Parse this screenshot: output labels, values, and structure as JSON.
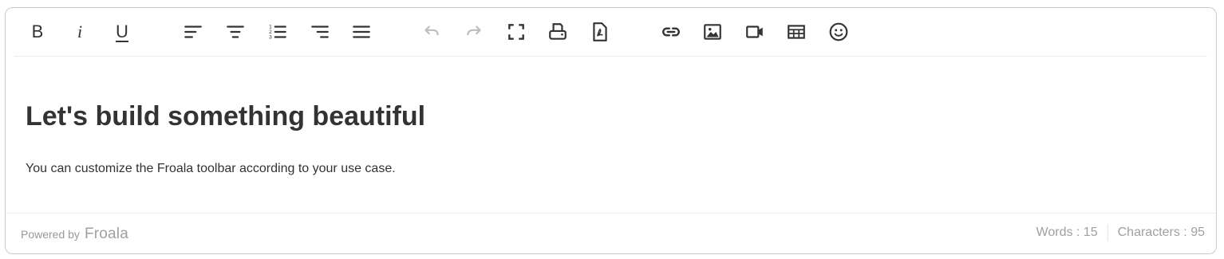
{
  "toolbar": {
    "bold_label": "B",
    "italic_label": "i",
    "underline_label": "U",
    "icons": [
      "align-left-icon",
      "align-center-icon",
      "ordered-list-icon",
      "align-right-icon",
      "align-justify-icon",
      "undo-icon",
      "redo-icon",
      "fullscreen-icon",
      "print-icon",
      "pdf-icon",
      "link-icon",
      "image-icon",
      "video-icon",
      "table-icon",
      "emoticon-icon"
    ]
  },
  "content": {
    "heading": "Let's build something beautiful",
    "paragraph": "You can customize the Froala toolbar according to your use case."
  },
  "footer": {
    "powered_by": "Powered by",
    "brand": "Froala",
    "words": "Words : 15",
    "characters": "Characters : 95"
  },
  "colors": {
    "text": "#333333",
    "disabled": "#bdbdbd",
    "border": "#cccccc",
    "muted": "#a0a0a0"
  }
}
